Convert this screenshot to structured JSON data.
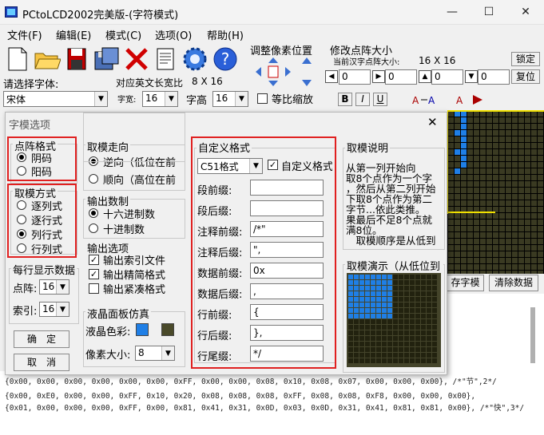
{
  "window": {
    "title": "PCtoLCD2002完美版-(字符模式)"
  },
  "menu": [
    "文件(F)",
    "编辑(E)",
    "模式(C)",
    "选项(O)",
    "帮助(H)"
  ],
  "toolbar": {
    "pixel_adjust_label": "调整像素位置",
    "modify_dot_size_label": "修改点阵大小",
    "current_size_label": "当前汉字点阵大小:",
    "current_size_value": "16 X 16",
    "lock_button": "锁定",
    "reset_button": "复位",
    "spin_values": [
      "0",
      "0",
      "0",
      "0"
    ],
    "font_select_label": "请选择字体:",
    "font_value": "宋体",
    "english_size_label": "对应英文长宽比",
    "english_size_value": "8 X 16",
    "width_label": "字宽:",
    "width_value": "16",
    "height_label": "字高",
    "height_value": "16",
    "proportional_label": "等比缩放",
    "bold_btn": "B",
    "italic_btn": "I",
    "underline_btn": "U"
  },
  "dialog": {
    "title": "字模选项",
    "dot_format": {
      "label": "点阵格式",
      "options": [
        "阴码",
        "阳码"
      ],
      "selected": 0
    },
    "scan_mode": {
      "label": "取模方式",
      "options": [
        "逐列式",
        "逐行式",
        "列行式",
        "行列式"
      ],
      "selected": 2
    },
    "direction": {
      "label": "取模走向",
      "options": [
        "逆向（低位在前",
        "顺向（高位在前"
      ],
      "selected": 0
    },
    "output_number": {
      "label": "输出数制",
      "options": [
        "十六进制数",
        "十进制数"
      ],
      "selected": 0
    },
    "output_options": {
      "label": "输出选项",
      "items": [
        {
          "label": "输出索引文件",
          "checked": true
        },
        {
          "label": "输出精简格式",
          "checked": true
        },
        {
          "label": "输出紧凑格式",
          "checked": false
        }
      ]
    },
    "per_line": {
      "label": "每行显示数据",
      "dot_label": "点阵:",
      "dot_value": "16",
      "index_label": "索引:",
      "index_value": "16"
    },
    "lcd_sim": {
      "label": "液晶面板仿真",
      "color_label": "液晶色彩:",
      "pixel_label": "像素大小:",
      "pixel_value": "8",
      "colors": [
        "#1f7fe6",
        "#4a4a2a"
      ]
    },
    "ok_button": "确　定",
    "cancel_button": "取　消",
    "custom_format": {
      "label": "自定义格式",
      "format_value": "C51格式",
      "custom_check_label": "自定义格式",
      "custom_checked": true,
      "fields": [
        {
          "label": "段前缀:",
          "value": ""
        },
        {
          "label": "段后缀:",
          "value": ""
        },
        {
          "label": "注释前缀:",
          "value": "/*\""
        },
        {
          "label": "注释后缀:",
          "value": "\","
        },
        {
          "label": "数据前缀:",
          "value": "0x"
        },
        {
          "label": "数据后缀:",
          "value": ","
        },
        {
          "label": "行前缀:",
          "value": "{"
        },
        {
          "label": "行后缀:",
          "value": "},"
        },
        {
          "label": "行尾缀:",
          "value": "*/"
        }
      ]
    },
    "explain": {
      "label": "取模说明",
      "lines": [
        "从第一列开始向",
        "取8个点作为一个字",
        "，然后从第二列开始",
        "下取8个点作为第二",
        "字节...依此类推。",
        "果最后不足8个点就",
        "满8位。",
        "　取模顺序是从低到"
      ]
    },
    "demo": {
      "label": "取模演示（从低位到"
    }
  },
  "side_buttons": {
    "save": "存字模",
    "clear": "清除数据"
  },
  "output": {
    "lines": [
      "{0x00, 0x00, 0x00, 0x00, 0x00, 0x00, 0xFF, 0x00, 0x00, 0x08, 0x10, 0x08, 0x07, 0x00, 0x00, 0x00}, /*\"节\",2*/",
      "{0x00, 0xE0, 0x00, 0x00, 0xFF, 0x10, 0x20, 0x08, 0x08, 0x08, 0xFF, 0x08, 0x08, 0xF8, 0x00, 0x00, 0x00},",
      "{0x01, 0x00, 0x00, 0x00, 0xFF, 0x00, 0x81, 0x41, 0x31, 0x0D, 0x03, 0x0D, 0x31, 0x41, 0x81, 0x81, 0x00}, /*\"快\",3*/"
    ]
  }
}
